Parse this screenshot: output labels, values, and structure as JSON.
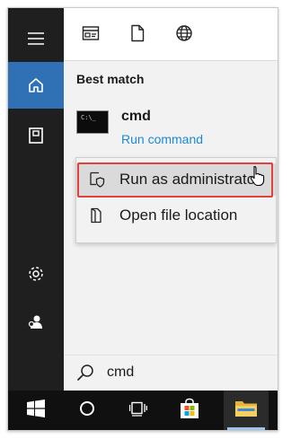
{
  "rail": {
    "items": [
      {
        "name": "menu-icon"
      },
      {
        "name": "home-icon"
      },
      {
        "name": "documents-icon"
      },
      {
        "name": "settings-icon"
      },
      {
        "name": "user-icon"
      }
    ],
    "accent": "#2f71b4"
  },
  "tabs": [
    {
      "name": "apps-tab-icon"
    },
    {
      "name": "document-tab-icon"
    },
    {
      "name": "web-tab-icon"
    }
  ],
  "results": {
    "section_label": "Best match",
    "top": {
      "title": "cmd",
      "subtitle": "Run command",
      "icon": "command-prompt-icon"
    }
  },
  "context_menu": {
    "items": [
      {
        "label": "Run as administrator",
        "icon": "shield-icon",
        "highlighted": true
      },
      {
        "label": "Open file location",
        "icon": "file-location-icon",
        "highlighted": false
      }
    ],
    "highlight_color": "#e0413b"
  },
  "search": {
    "value": "cmd",
    "icon": "search-icon"
  },
  "taskbar": {
    "items": [
      {
        "name": "windows-start-icon"
      },
      {
        "name": "cortana-icon"
      },
      {
        "name": "task-view-icon"
      },
      {
        "name": "store-icon"
      },
      {
        "name": "file-explorer-icon",
        "active": true
      }
    ]
  },
  "colors": {
    "link": "#1e88d2",
    "rail_bg": "#1f1f1f",
    "taskbar_bg": "#101010"
  }
}
